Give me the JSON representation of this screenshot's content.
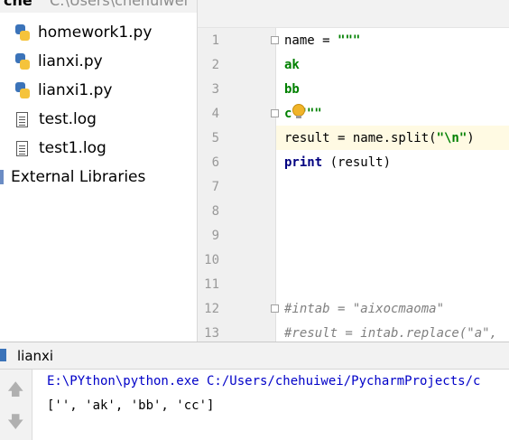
{
  "project": {
    "folder": "che",
    "path": "C:\\Users\\chehuiwei",
    "files": [
      {
        "name": "homework1.py",
        "type": "python-file-icon"
      },
      {
        "name": "lianxi.py",
        "type": "python-file-icon"
      },
      {
        "name": "lianxi1.py",
        "type": "python-file-icon"
      },
      {
        "name": "test.log",
        "type": "text-file-icon"
      },
      {
        "name": "test1.log",
        "type": "text-file-icon"
      }
    ],
    "external_libraries": "External Libraries"
  },
  "editor": {
    "line_numbers": [
      "1",
      "2",
      "3",
      "4",
      "5",
      "6",
      "7",
      "8",
      "9",
      "10",
      "11",
      "12",
      "13"
    ],
    "code": {
      "l1_a": "name = ",
      "l1_b": "\"\"\"",
      "l2": "ak",
      "l3": "bb",
      "l4_a": "c",
      "l4_b": "\"\"\"",
      "l5_a": "result = name.split(",
      "l5_b": "\"\\n\"",
      "l5_c": ")",
      "l6_a": "print",
      "l6_b": " (result)",
      "l12": "#intab = \"aixocmaoma\"",
      "l13": "#result = intab.replace(\"a\","
    }
  },
  "run": {
    "title": "lianxi",
    "output": [
      "E:\\PYthon\\python.exe C:/Users/chehuiwei/PycharmProjects/c",
      "['', 'ak', 'bb', 'cc']"
    ]
  }
}
